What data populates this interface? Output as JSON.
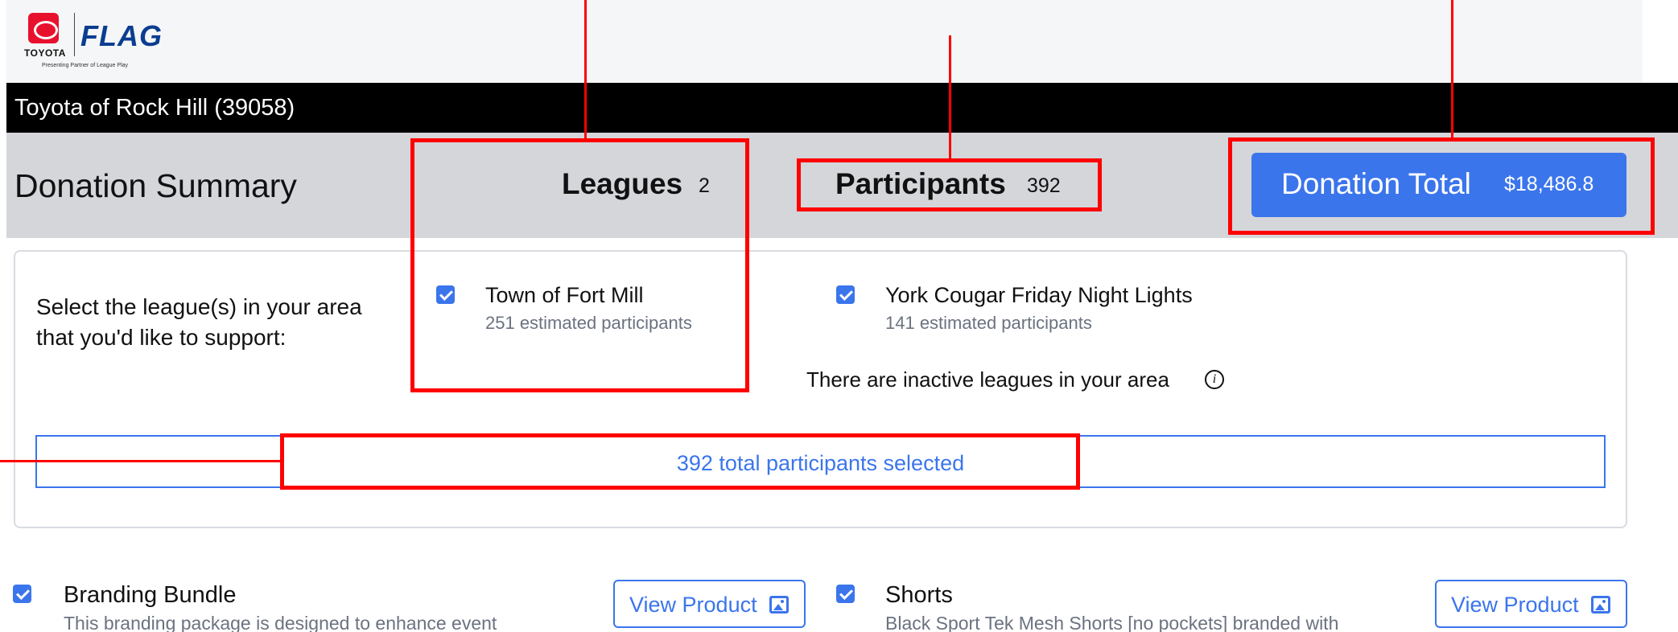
{
  "header": {
    "brand_word": "TOYOTA",
    "flag_logo_text": "FLAG",
    "tagline": "Presenting Partner of League Play",
    "dealer_name": "Toyota of Rock Hill (39058)"
  },
  "summary": {
    "title": "Donation Summary",
    "leagues_label": "Leagues",
    "leagues_value": "2",
    "participants_label": "Participants",
    "participants_value": "392",
    "donation_label": "Donation Total",
    "donation_value": "$18,486.8"
  },
  "leagues_section": {
    "prompt": "Select the league(s) in your area that you'd like to support:",
    "leagues": [
      {
        "name": "Town of Fort Mill",
        "participants": "251 estimated participants",
        "checked": true
      },
      {
        "name": "York Cougar Friday Night Lights",
        "participants": "141 estimated participants",
        "checked": true
      }
    ],
    "inactive_note": "There are inactive leagues in your area",
    "total_selected": "392 total participants selected"
  },
  "products": [
    {
      "title": "Branding Bundle",
      "description": "This branding package is designed to enhance event",
      "button_label": "View Product",
      "checked": true
    },
    {
      "title": "Shorts",
      "description": "Black Sport Tek Mesh Shorts [no pockets] branded with",
      "button_label": "View Product",
      "checked": true
    }
  ],
  "colors": {
    "accent": "#3b75ec",
    "annotation": "#ff0000",
    "dealer_bar": "#000000",
    "summary_bar": "#d4d6da"
  },
  "icons": [
    "toyota-logo-icon",
    "nfl-flag-logo-icon",
    "checkbox-checked-icon",
    "info-icon",
    "image-icon"
  ]
}
